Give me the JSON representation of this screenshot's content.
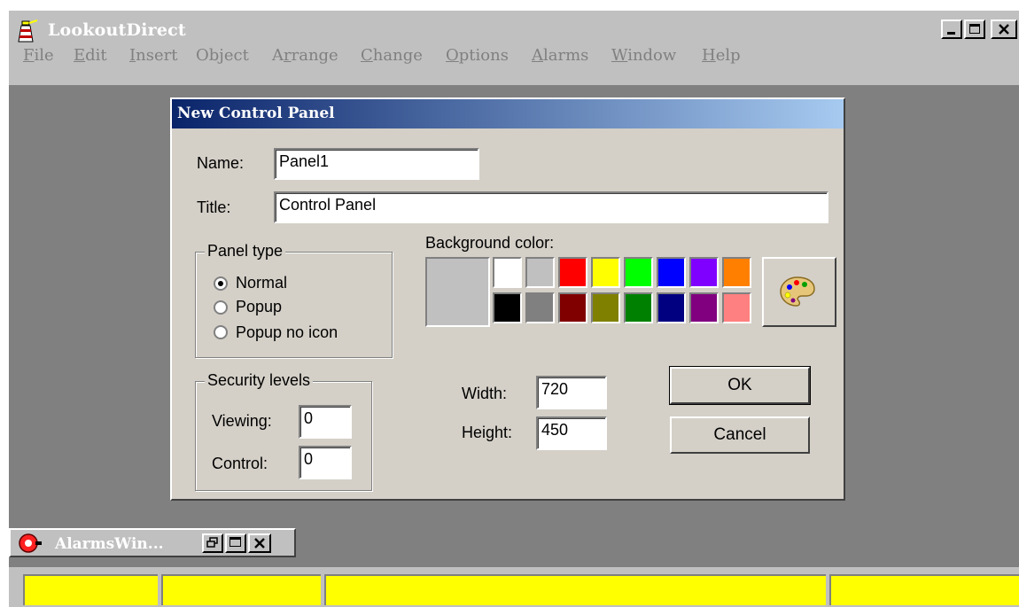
{
  "app": {
    "title": "LookoutDirect"
  },
  "menu": [
    {
      "label": "File"
    },
    {
      "label": "Edit"
    },
    {
      "label": "Insert"
    },
    {
      "label": "Object"
    },
    {
      "label": "Arrange"
    },
    {
      "label": "Change"
    },
    {
      "label": "Options"
    },
    {
      "label": "Alarms"
    },
    {
      "label": "Window"
    },
    {
      "label": "Help"
    }
  ],
  "dialog": {
    "title": "New Control Panel",
    "name_label": "Name:",
    "name_value": "Panel1",
    "title_label": "Title:",
    "title_value": "Control Panel",
    "panel_type": {
      "label": "Panel type",
      "options": [
        "Normal",
        "Popup",
        "Popup no icon"
      ],
      "selected": "Normal"
    },
    "security": {
      "label": "Security levels",
      "viewing_label": "Viewing:",
      "viewing_value": "0",
      "control_label": "Control:",
      "control_value": "0"
    },
    "background": {
      "label": "Background color:",
      "current": "#c0c0c0",
      "top_row": [
        "#ffffff",
        "#c0c0c0",
        "#ff0000",
        "#ffff00",
        "#00ff00",
        "#0000ff",
        "#8000ff",
        "#ff8000"
      ],
      "bottom_row": [
        "#000000",
        "#808080",
        "#800000",
        "#808000",
        "#008000",
        "#000080",
        "#800080",
        "#ff8080"
      ],
      "palette_icon": "palette-icon"
    },
    "width_label": "Width:",
    "width_value": "720",
    "height_label": "Height:",
    "height_value": "450",
    "ok_label": "OK",
    "cancel_label": "Cancel"
  },
  "alarms_window": {
    "title": "AlarmsWin..."
  },
  "colors": {
    "accent": "#0a246a",
    "status_bar": "#ffff00"
  }
}
